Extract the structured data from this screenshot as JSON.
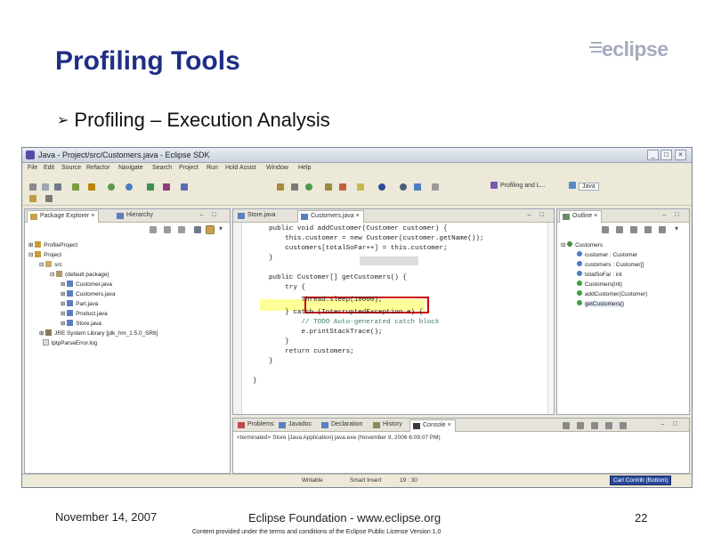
{
  "slide": {
    "title": "Profiling Tools",
    "bullet": "Profiling – Execution Analysis",
    "logo_text": "eclipse"
  },
  "window": {
    "title": "Java - Project/src/Customers.java - Eclipse SDK",
    "menu": [
      "File",
      "Edit",
      "Source",
      "Refactor",
      "Navigate",
      "Search",
      "Project",
      "Run",
      "Hold Assist",
      "Window",
      "Help"
    ],
    "perspectives": [
      "Profiling and L...",
      "Java"
    ]
  },
  "left_pane": {
    "tabs": [
      "Package Explorer",
      "Hierarchy"
    ],
    "tree": [
      "ProfileProject",
      "Project",
      "src",
      "(default package)",
      "Customer.java",
      "Customers.java",
      "Part.java",
      "Product.java",
      "Store.java",
      "JRE System Library [jdk_hm_1.5.0_SR6]",
      "tptpParseError.log"
    ]
  },
  "editor": {
    "tabs": [
      "Store.java",
      "Customers.java"
    ],
    "lines": [
      "public void addCustomer(Customer customer) {",
      "    this.customer = new Customer(customer.getName());",
      "    customers[totalSoFar++] = this.customer;",
      "}",
      "",
      "public Customer[] getCustomers() {",
      "    try {",
      "        Thread.sleep(10000);",
      "    } catch (InterruptedException e) {",
      "        // TODO Auto-generated catch block",
      "        e.printStackTrace();",
      "    }",
      "    return customers;",
      "}",
      "",
      "}"
    ]
  },
  "outline": {
    "tab": "Outline",
    "items": [
      "Customers",
      "customer : Customer",
      "customers : Customer[]",
      "totalSoFar : int",
      "Customers(int)",
      "addCustomer(Customer)",
      "getCustomers()"
    ]
  },
  "console": {
    "tabs": [
      "Problems",
      "Javadoc",
      "Declaration",
      "History",
      "Console"
    ],
    "text": "<terminated> Store [Java Application] java.exe (November 9, 2006 6:09:07 PM)"
  },
  "status": {
    "writable": "Writable",
    "insert": "Smart Insert",
    "position": "19 : 30",
    "user": "Carl Contrib (Bottom)"
  },
  "footer": {
    "date": "November 14, 2007",
    "org": "Eclipse Foundation - www.eclipse.org",
    "page": "22",
    "license": "Content provided under the terms and conditions of the Eclipse Public License Version 1.0"
  },
  "colors": {
    "title": "#1f2e86",
    "highlight_box": "#cc0000",
    "highlight_line": "#ffff99"
  }
}
